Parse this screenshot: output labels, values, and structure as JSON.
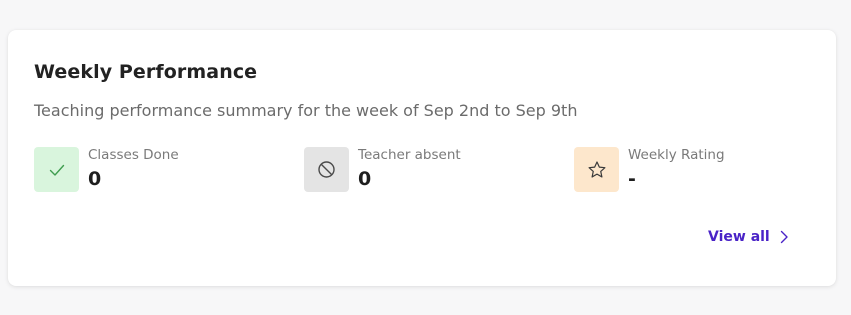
{
  "card": {
    "title": "Weekly Performance",
    "subtitle": "Teaching performance summary for the week of Sep 2nd to Sep 9th"
  },
  "stats": [
    {
      "label": "Classes Done",
      "value": "0",
      "icon": "check-icon",
      "icon_bg": "#d9f5dd",
      "icon_color": "#3f9d4f"
    },
    {
      "label": "Teacher absent",
      "value": "0",
      "icon": "no-entry-icon",
      "icon_bg": "#e4e4e4",
      "icon_color": "#4a4a4a"
    },
    {
      "label": "Weekly Rating",
      "value": "-",
      "icon": "star-icon",
      "icon_bg": "#fde7cc",
      "icon_color": "#3a3a3a"
    }
  ],
  "view_all": {
    "label": "View all",
    "color": "#4a23c7"
  }
}
